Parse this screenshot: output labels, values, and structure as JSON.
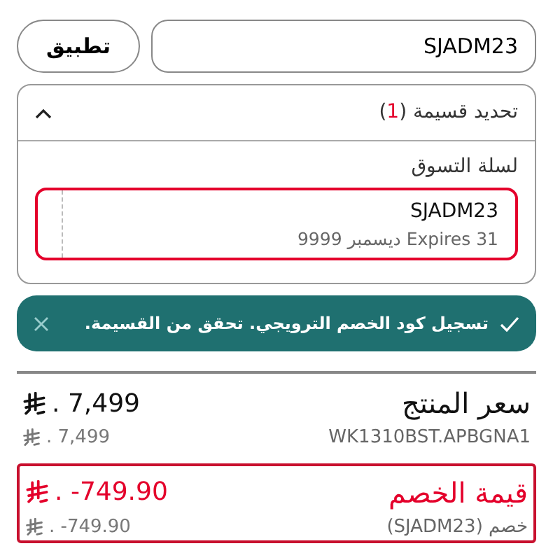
{
  "coupon_form": {
    "code_field": {
      "value": "SJADM23"
    },
    "apply_button": "تطبيق"
  },
  "coupon_panel": {
    "title": "تحديد قسيمة",
    "count_brackets": [
      "(",
      ")"
    ],
    "count": "1",
    "expanded": true,
    "section_label": "لسلة التسوق",
    "coupons": [
      {
        "code": "SJADM23",
        "expiry": "Expires 31 ديسمبر 9999",
        "selected": true
      }
    ]
  },
  "toast": {
    "message": "تسجيل كود الخصم الترويجي. تحقق من القسيمة."
  },
  "summary": [
    {
      "kind": "price",
      "label": "سعر المنتج",
      "amount": ". 7,499",
      "sublabel": "WK1310BST.APBGNA1",
      "subamount": ". 7,499"
    },
    {
      "kind": "discount",
      "label": "قيمة الخصم",
      "amount": ". -749.90",
      "sublabel": "خصم (SJADM23)",
      "subamount": ". -749.90"
    }
  ]
}
